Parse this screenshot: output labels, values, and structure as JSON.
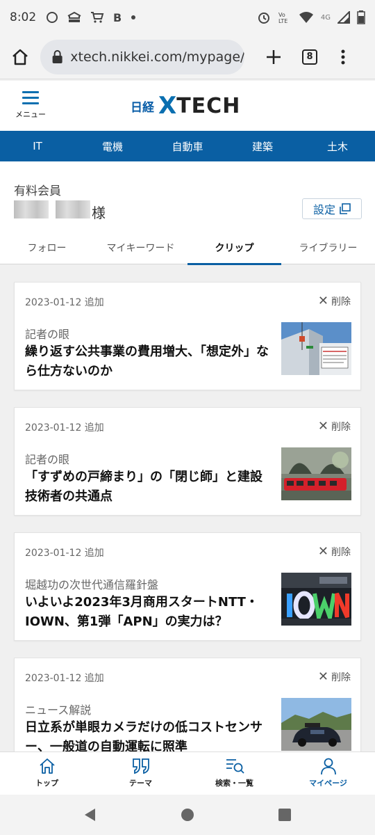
{
  "status_bar": {
    "time": "8:02",
    "network_label": "4G",
    "volte_label": "Vo\nLTE"
  },
  "browser": {
    "url": "xtech.nikkei.com/mypage/c",
    "tab_count": "8"
  },
  "site": {
    "menu_label": "メニュー",
    "logo_nikkei": "日経",
    "logo_x": "X",
    "logo_tech": "TECH",
    "categories": [
      "IT",
      "電機",
      "自動車",
      "建築",
      "土木"
    ]
  },
  "member": {
    "tier": "有料会員",
    "name_suffix": "様",
    "settings_label": "設定"
  },
  "tabs": [
    "フォロー",
    "マイキーワード",
    "クリップ",
    "ライブラリー"
  ],
  "clips": [
    {
      "date": "2023-01-12 追加",
      "delete_label": "削除",
      "category": "記者の眼",
      "title": "繰り返す公共事業の費用増大、「想定外」なら仕方ないのか"
    },
    {
      "date": "2023-01-12 追加",
      "delete_label": "削除",
      "category": "記者の眼",
      "title": "「すずめの戸締まり」の「閉じ師」と建設技術者の共通点"
    },
    {
      "date": "2023-01-12 追加",
      "delete_label": "削除",
      "category": "堀越功の次世代通信羅針盤",
      "title": "いよいよ2023年3月商用スタートNTT・IOWN、第1弾「APN」の実力は？"
    },
    {
      "date": "2023-01-12 追加",
      "delete_label": "削除",
      "category": "ニュース解説",
      "title": "日立系が単眼カメラだけの低コストセンサー、一般道の自動運転に照準"
    }
  ],
  "bottom_nav": {
    "top": "トップ",
    "theme": "テーマ",
    "search": "検索・一覧",
    "mypage": "マイページ"
  },
  "colors": {
    "brand_blue": "#0a5fa3",
    "nav_bar": "#0a5fa3"
  }
}
